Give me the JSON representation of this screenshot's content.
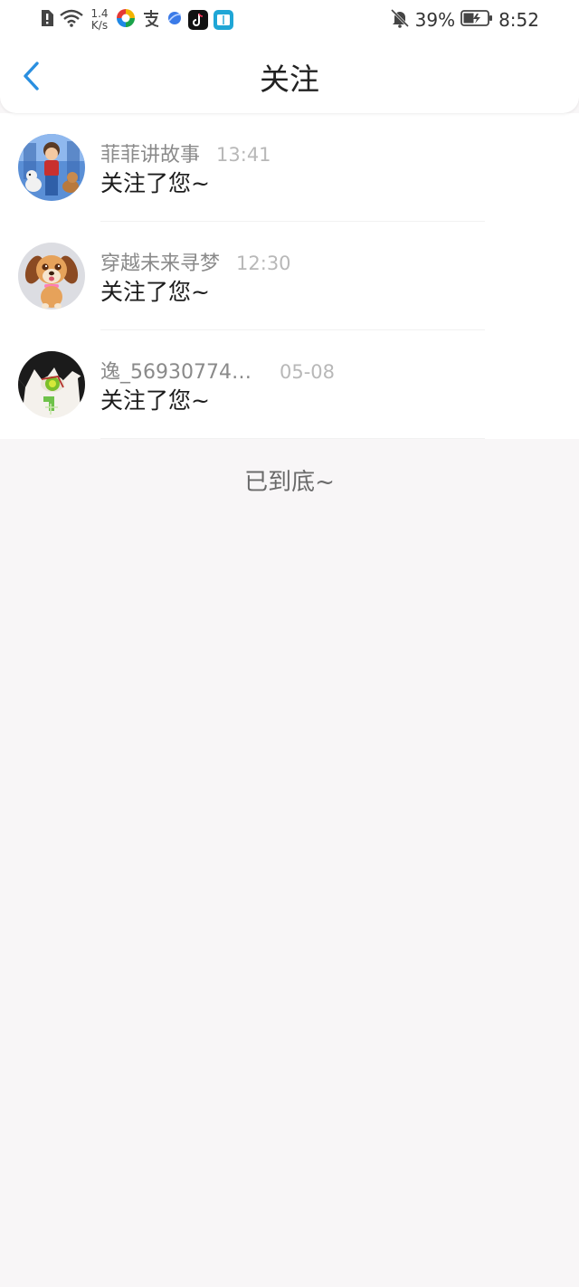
{
  "status_bar": {
    "net_speed_value": "1.4",
    "net_speed_unit": "K/s",
    "battery": "39%",
    "time": "8:52",
    "left_icons": [
      "alert-icon",
      "wifi-icon",
      "app-360-icon",
      "app-alipay-icon",
      "app-browser-icon",
      "app-tiktok-icon",
      "app-reader-icon"
    ],
    "right_icons": [
      "bell-muted-icon",
      "battery-charging-icon"
    ]
  },
  "header": {
    "back_icon": "chevron-left-icon",
    "title": "关注"
  },
  "colors": {
    "accent": "#2a8fe0",
    "background": "#f8f6f7",
    "card": "#ffffff"
  },
  "follows": [
    {
      "name": "菲菲讲故事",
      "time": "13:41",
      "message": "关注了您~",
      "avatar": "cartoon-boy-avatar"
    },
    {
      "name": "穿越未来寻梦",
      "time": "12:30",
      "message": "关注了您~",
      "avatar": "puppy-avatar"
    },
    {
      "name": "逸_569307747...",
      "time": "05-08",
      "message": "关注了您~",
      "avatar": "anime-eye-avatar"
    }
  ],
  "footer": {
    "end_text": "已到底~"
  }
}
